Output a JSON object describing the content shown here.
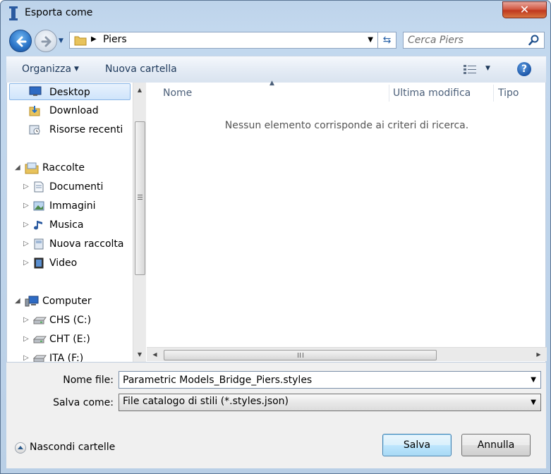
{
  "window": {
    "title": "Esporta come",
    "close_label": "✕"
  },
  "address": {
    "path": "Piers",
    "search_placeholder": "Cerca Piers"
  },
  "toolbar": {
    "organize_label": "Organizza",
    "new_folder_label": "Nuova cartella",
    "help_label": "?"
  },
  "sidebar": {
    "items": [
      {
        "label": "Desktop"
      },
      {
        "label": "Download"
      },
      {
        "label": "Risorse recenti"
      },
      {
        "label": "Raccolte"
      },
      {
        "label": "Documenti"
      },
      {
        "label": "Immagini"
      },
      {
        "label": "Musica"
      },
      {
        "label": "Nuova raccolta"
      },
      {
        "label": "Video"
      },
      {
        "label": "Computer"
      },
      {
        "label": "CHS (C:)"
      },
      {
        "label": "CHT (E:)"
      },
      {
        "label": "ITA (F:)"
      }
    ]
  },
  "content": {
    "columns": [
      "Nome",
      "Ultima modifica",
      "Tipo"
    ],
    "empty_message": "Nessun elemento corrisponde ai criteri di ricerca."
  },
  "form": {
    "file_name_label": "Nome file:",
    "file_name_value": "Parametric Models_Bridge_Piers.styles",
    "save_as_label": "Salva come:",
    "save_as_value": "File catalogo di stili (*.styles.json)",
    "hide_folders_label": "Nascondi cartelle",
    "save_button": "Salva",
    "cancel_button": "Annulla"
  },
  "colors": {
    "accent": "#2a73c6",
    "selection": "#cfe4fb"
  }
}
